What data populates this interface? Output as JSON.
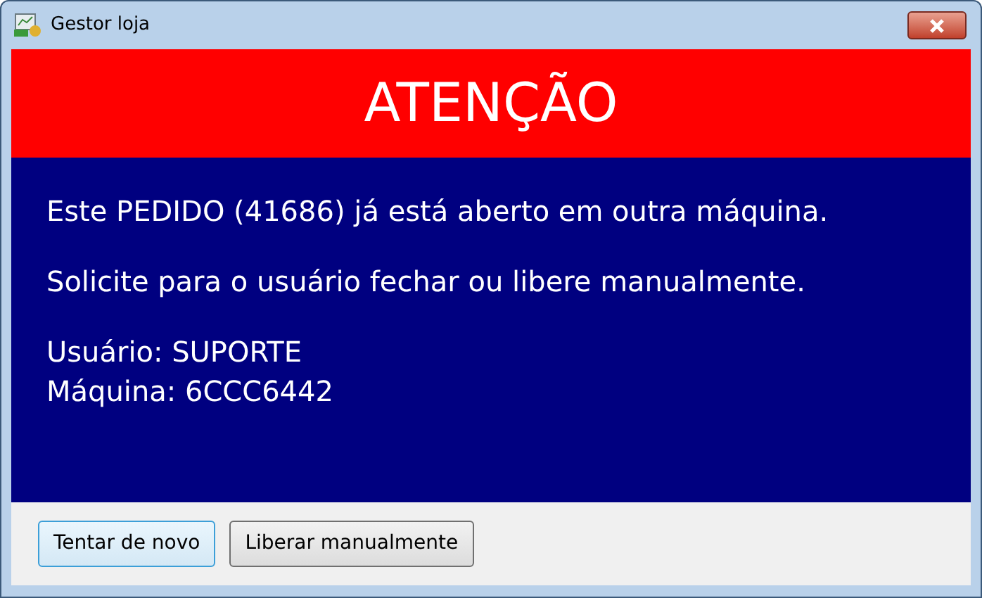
{
  "window": {
    "title": "Gestor loja"
  },
  "banner": {
    "title": "ATENÇÃO"
  },
  "message": {
    "paragraphs": [
      {
        "lines": [
          "Este PEDIDO (41686) já está aberto em outra máquina."
        ]
      },
      {
        "lines": [
          "Solicite para o usuário fechar ou libere manualmente."
        ]
      },
      {
        "lines": [
          "Usuário: SUPORTE",
          "Máquina: 6CCC6442"
        ]
      }
    ]
  },
  "buttons": [
    {
      "label": "Tentar de novo",
      "default": true
    },
    {
      "label": "Liberar manualmente",
      "default": false
    }
  ]
}
